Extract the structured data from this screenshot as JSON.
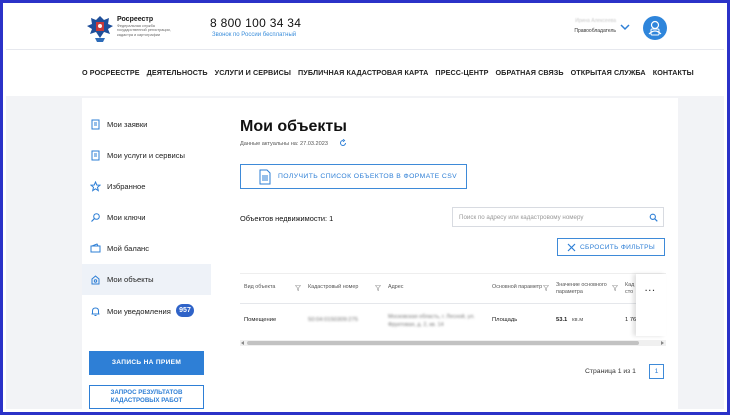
{
  "header": {
    "brand_name": "Росреестр",
    "brand_sub": "Федеральная служба государственной регистрации, кадастра и картографии",
    "phone": "8 800 100 34 34",
    "phone_note": "Звонок по России бесплатный",
    "user_name": "Ирина Алексеева",
    "user_role": "Правообладатель"
  },
  "nav": {
    "items": [
      "О РОСРЕЕСТРЕ",
      "ДЕЯТЕЛЬНОСТЬ",
      "УСЛУГИ И СЕРВИСЫ",
      "ПУБЛИЧНАЯ КАДАСТРОВАЯ КАРТА",
      "ПРЕСС-ЦЕНТР",
      "ОБРАТНАЯ СВЯЗЬ",
      "ОТКРЫТАЯ СЛУЖБА",
      "КОНТАКТЫ"
    ]
  },
  "sidebar": {
    "items": [
      {
        "label": "Мои заявки",
        "icon": "document-icon"
      },
      {
        "label": "Мои услуги и сервисы",
        "icon": "document-icon"
      },
      {
        "label": "Избранное",
        "icon": "star-icon"
      },
      {
        "label": "Мои ключи",
        "icon": "key-icon"
      },
      {
        "label": "Мой баланс",
        "icon": "wallet-icon"
      },
      {
        "label": "Мои объекты",
        "icon": "house-icon",
        "active": true
      },
      {
        "label": "Мои уведомления",
        "icon": "bell-icon",
        "badge": "957"
      }
    ],
    "appointment_button": "ЗАПИСЬ НА ПРИЕМ",
    "cadastral_button_line1": "ЗАПРОС РЕЗУЛЬТАТОВ",
    "cadastral_button_line2": "КАДАСТРОВЫХ РАБОТ"
  },
  "main": {
    "title": "Мои объекты",
    "data_actual": "Данные актуальны на: 27.03.2023",
    "csv_button": "ПОЛУЧИТЬ СПИСОК ОБЪЕКТОВ В ФОРМАТЕ CSV",
    "count_label": "Объектов недвижимости: 1",
    "search_placeholder": "Поиск по адресу или кадастровому номеру",
    "reset_button": "СБРОСИТЬ ФИЛЬТРЫ",
    "table": {
      "headers": {
        "type": "Вид объекта",
        "cadastral": "Кадастровый номер",
        "address": "Адрес",
        "param": "Основной параметр",
        "value_line1": "Значение основного",
        "value_line2": "параметра",
        "cost_line1": "Кад",
        "cost_line2": "сто"
      },
      "row": {
        "type": "Помещение",
        "cadastral": "50:04:0150309:275",
        "address_line1": "Московская область, г. Лесной, ул.",
        "address_line2": "Фруктовая, д. 2, кв. 14",
        "param": "Площадь",
        "value": "53.1",
        "unit": "кв.м",
        "cost": "1 76"
      }
    },
    "pager_text": "Страница 1 из 1",
    "pager_current": "1"
  },
  "colors": {
    "accent": "#2e7fd6",
    "badge": "#2f63c8",
    "frame": "#2b32c8",
    "background": "#f2f3f6"
  }
}
